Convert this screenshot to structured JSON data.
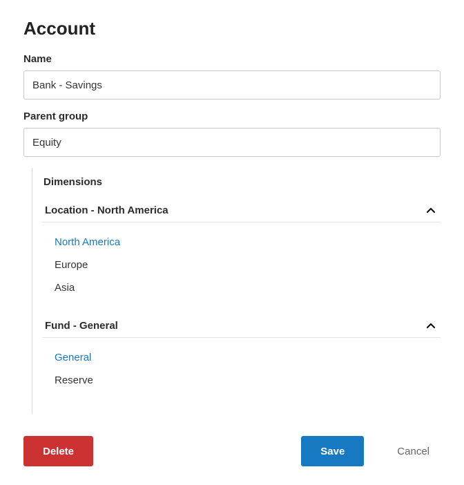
{
  "title": "Account",
  "fields": {
    "name": {
      "label": "Name",
      "value": "Bank - Savings"
    },
    "parent_group": {
      "label": "Parent group",
      "value": "Equity"
    }
  },
  "dimensions": {
    "title": "Dimensions",
    "sections": [
      {
        "header": "Location - North America",
        "options": [
          {
            "label": "North America",
            "selected": true
          },
          {
            "label": "Europe",
            "selected": false
          },
          {
            "label": "Asia",
            "selected": false
          }
        ]
      },
      {
        "header": "Fund - General",
        "options": [
          {
            "label": "General",
            "selected": true
          },
          {
            "label": "Reserve",
            "selected": false
          }
        ]
      }
    ]
  },
  "buttons": {
    "delete": "Delete",
    "save": "Save",
    "cancel": "Cancel"
  }
}
